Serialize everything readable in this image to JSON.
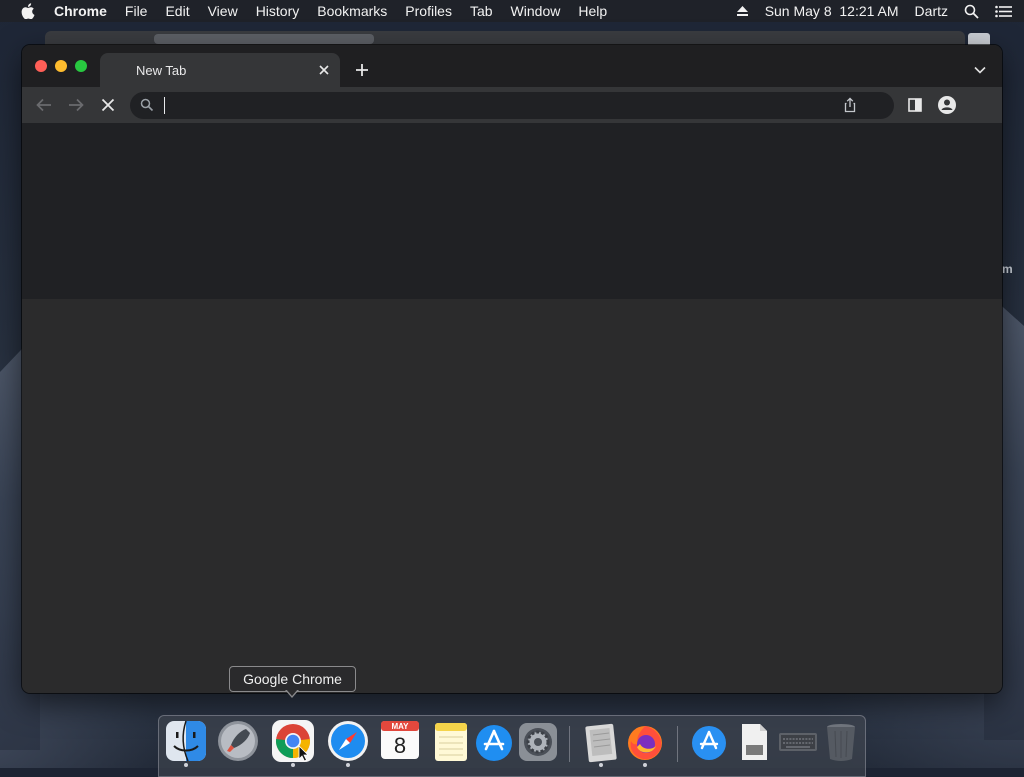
{
  "menubar": {
    "app_name": "Chrome",
    "items": [
      "File",
      "Edit",
      "View",
      "History",
      "Bookmarks",
      "Profiles",
      "Tab",
      "Window",
      "Help"
    ],
    "datetime": "Sun May 8  12:21 AM",
    "user": "Dartz"
  },
  "window": {
    "tab_title": "New Tab",
    "omnibox_value": "",
    "omnibox_placeholder": ""
  },
  "desktop": {
    "edge_text": "m"
  },
  "tooltip": {
    "text": "Google Chrome"
  },
  "dock": {
    "calendar_month": "MAY",
    "calendar_day": "8",
    "apps": [
      "finder-icon",
      "launchpad-icon",
      "chrome-icon",
      "safari-icon",
      "calendar-icon",
      "notes-icon",
      "app-store-icon",
      "system-preferences-icon",
      "archive-utility-icon",
      "firefox-icon",
      "app-store-folder-icon",
      "document-icon",
      "keyboard-icon",
      "trash-icon"
    ]
  },
  "colors": {
    "window_bg": "#2b2b2c",
    "titlebar_bg": "#1f1f21",
    "toolbar_bg": "#353638",
    "omnibox_bg": "#202124",
    "close": "#ff5f57",
    "minimize": "#febc2e",
    "zoom": "#28c840"
  }
}
